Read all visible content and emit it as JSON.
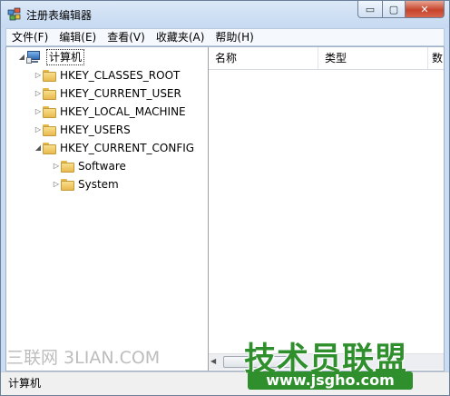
{
  "window": {
    "title": "注册表编辑器",
    "controls": {
      "minimize": "▭",
      "maximize": "▢",
      "close": "✕"
    }
  },
  "menu": [
    "文件(F)",
    "编辑(E)",
    "查看(V)",
    "收藏夹(A)",
    "帮助(H)"
  ],
  "tree": {
    "root": "计算机",
    "hives": [
      {
        "label": "HKEY_CLASSES_ROOT",
        "expanded": false
      },
      {
        "label": "HKEY_CURRENT_USER",
        "expanded": false
      },
      {
        "label": "HKEY_LOCAL_MACHINE",
        "expanded": false
      },
      {
        "label": "HKEY_USERS",
        "expanded": false
      },
      {
        "label": "HKEY_CURRENT_CONFIG",
        "expanded": true
      }
    ],
    "children": [
      {
        "label": "Software"
      },
      {
        "label": "System"
      }
    ]
  },
  "list": {
    "columns": [
      "名称",
      "类型",
      "数"
    ]
  },
  "status": {
    "text": "计算机"
  },
  "watermarks": {
    "site1": "三联网 3LIAN.COM",
    "brand_cn": "技术员联盟",
    "brand_url": "www.jsgho.com"
  },
  "colors": {
    "titlebar": "#c9dcf3",
    "close_button": "#c7442c",
    "brand_green": "#2f8f2c"
  }
}
